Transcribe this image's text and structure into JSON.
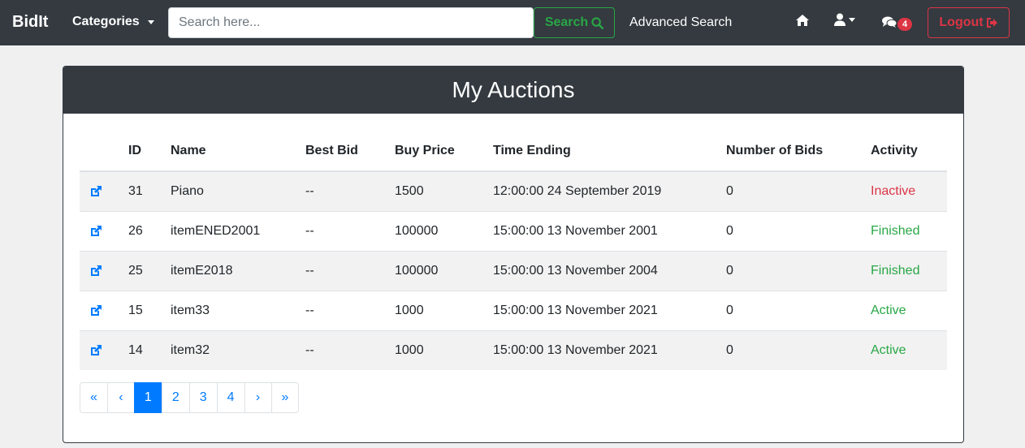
{
  "navbar": {
    "brand": "BidIt",
    "categories_label": "Categories",
    "search_placeholder": "Search here...",
    "search_label": "Search",
    "advanced_search_label": "Advanced Search",
    "messages_count": "4",
    "logout_label": "Logout"
  },
  "card": {
    "title": "My Auctions"
  },
  "table": {
    "headers": [
      "",
      "ID",
      "Name",
      "Best Bid",
      "Buy Price",
      "Time Ending",
      "Number of Bids",
      "Activity"
    ],
    "rows": [
      {
        "id": "31",
        "name": "Piano",
        "best_bid": "--",
        "buy_price": "1500",
        "time_ending": "12:00:00 24 September 2019",
        "bids": "0",
        "activity": "Inactive"
      },
      {
        "id": "26",
        "name": "itemENED2001",
        "best_bid": "--",
        "buy_price": "100000",
        "time_ending": "15:00:00 13 November 2001",
        "bids": "0",
        "activity": "Finished"
      },
      {
        "id": "25",
        "name": "itemE2018",
        "best_bid": "--",
        "buy_price": "100000",
        "time_ending": "15:00:00 13 November 2004",
        "bids": "0",
        "activity": "Finished"
      },
      {
        "id": "15",
        "name": "item33",
        "best_bid": "--",
        "buy_price": "1000",
        "time_ending": "15:00:00 13 November 2021",
        "bids": "0",
        "activity": "Active"
      },
      {
        "id": "14",
        "name": "item32",
        "best_bid": "--",
        "buy_price": "1000",
        "time_ending": "15:00:00 13 November 2021",
        "bids": "0",
        "activity": "Active"
      }
    ]
  },
  "pagination": {
    "first": "«",
    "prev": "‹",
    "pages": [
      "1",
      "2",
      "3",
      "4"
    ],
    "next": "›",
    "last": "»"
  },
  "colors": {
    "navbar_bg": "#343a40",
    "success": "#28a745",
    "danger": "#dc3545",
    "primary": "#007bff"
  },
  "icons": {
    "search": "search-icon",
    "home": "home-icon",
    "user": "user-icon",
    "messages": "comments-icon",
    "logout": "sign-out-icon",
    "edit": "external-link-icon"
  }
}
